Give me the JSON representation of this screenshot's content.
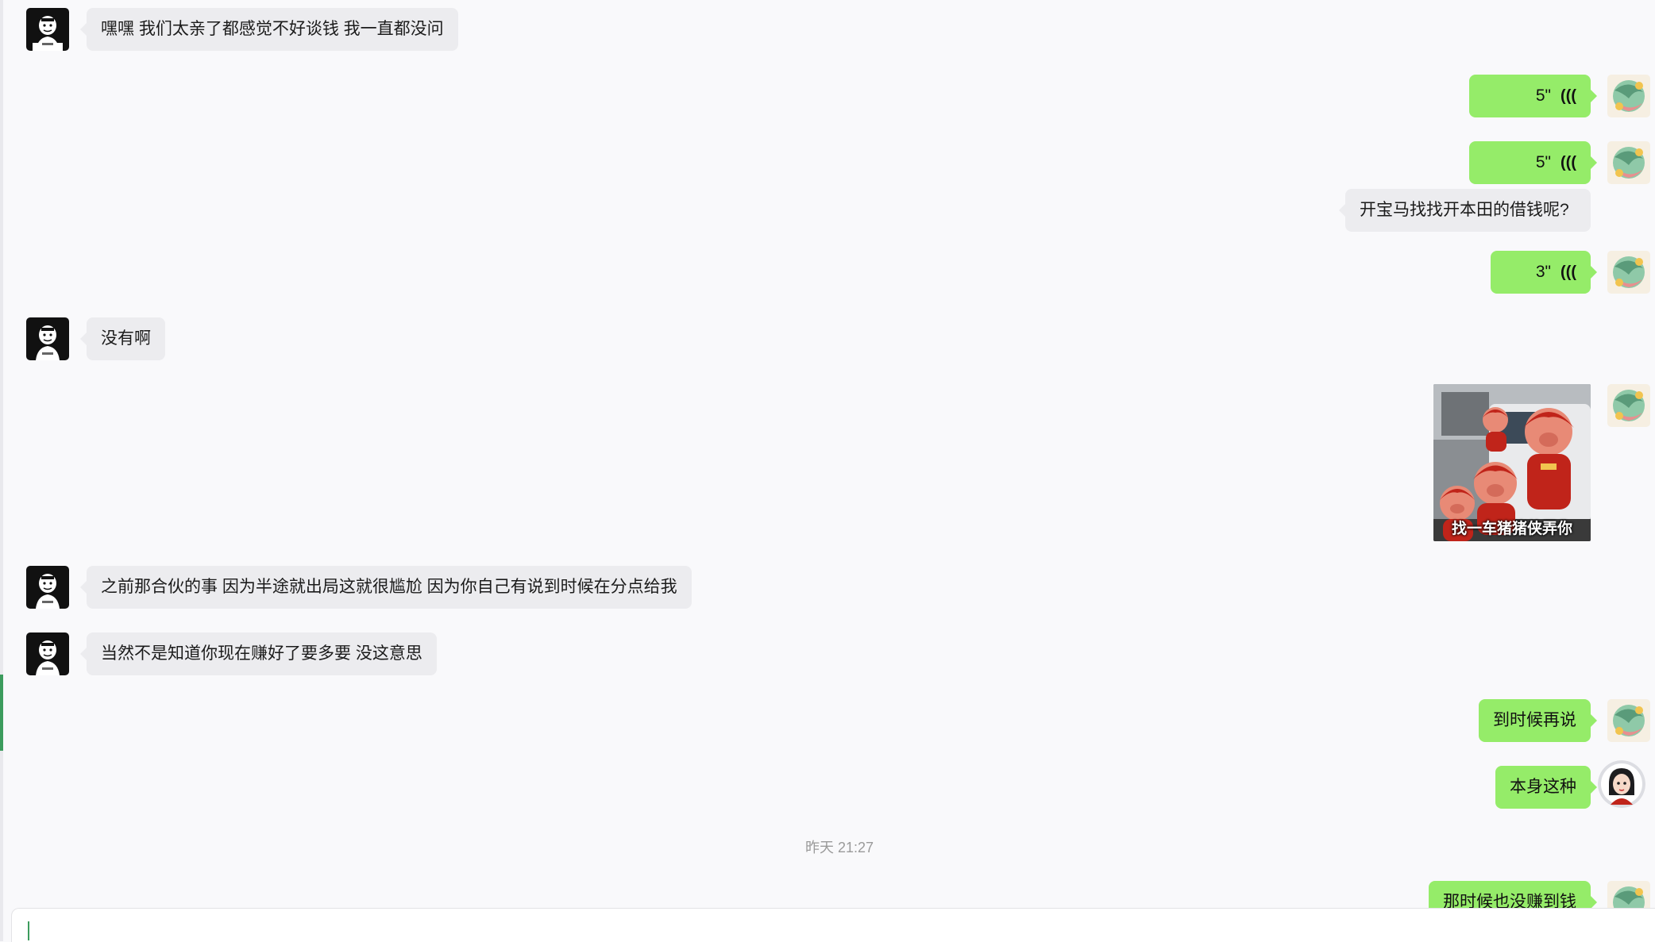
{
  "chat": {
    "messages": [
      {
        "side": "in",
        "type": "text",
        "text": "嘿嘿 我们太亲了都感觉不好谈钱 我一直都没问"
      },
      {
        "side": "out",
        "type": "voice",
        "duration": "5\""
      },
      {
        "side": "out",
        "type": "voice",
        "duration": "5\""
      },
      {
        "side": "out",
        "type": "text",
        "text": "开宝马找找开本田的借钱呢?"
      },
      {
        "side": "out",
        "type": "voice",
        "duration": "3\""
      },
      {
        "side": "in",
        "type": "text",
        "text": "没有啊"
      },
      {
        "side": "out",
        "type": "sticker",
        "caption": "找一车猪猪侠弄你"
      },
      {
        "side": "in",
        "type": "text",
        "text": "之前那合伙的事 因为半途就出局这就很尴尬 因为你自己有说到时候在分点给我"
      },
      {
        "side": "in",
        "type": "text",
        "text": "当然不是知道你现在赚好了要多要 没这意思"
      },
      {
        "side": "out",
        "type": "text",
        "text": "到时候再说"
      },
      {
        "side": "out",
        "type": "text",
        "text": "本身这种"
      },
      {
        "side": "system",
        "type": "timestamp",
        "text": "昨天 21:27"
      },
      {
        "side": "out",
        "type": "text",
        "text": "那时候也没赚到钱"
      }
    ]
  },
  "icons": {
    "voice": "voice-wave-icon",
    "contact_avatar": "contact-avatar",
    "self_avatar": "self-avatar"
  },
  "colors": {
    "incoming_bubble": "#ececef",
    "outgoing_bubble": "#95ec69",
    "background": "#f9f9fb",
    "accent": "#3c9c5d"
  },
  "input": {
    "value": ""
  }
}
